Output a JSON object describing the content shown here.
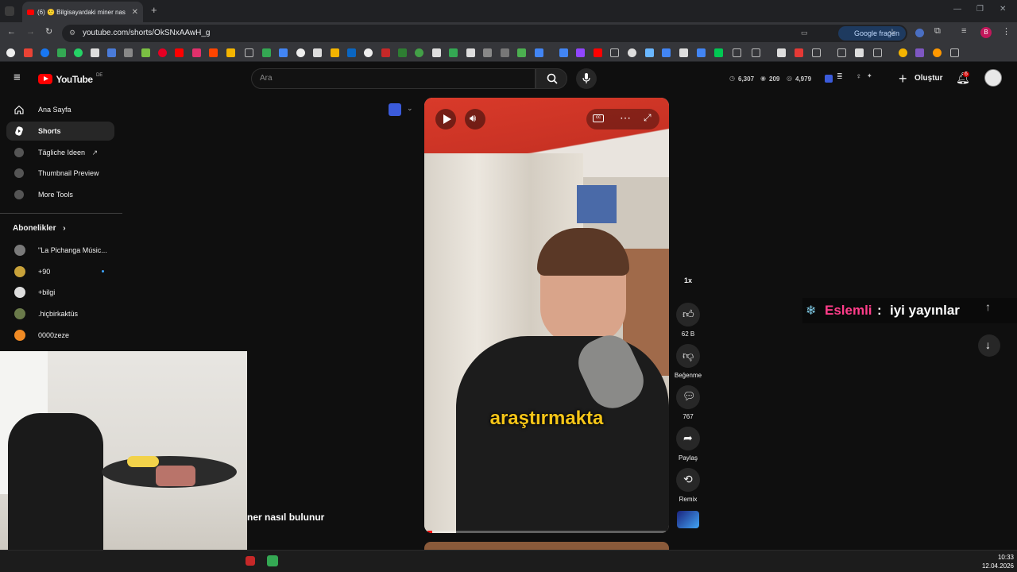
{
  "browser": {
    "tab_title": "(6) 🙂 Bilgisayardaki miner nas",
    "url": "youtube.com/shorts/OkSNxAAwH_g",
    "lens_button": "Google fragen",
    "profile_letter": "B"
  },
  "youtube": {
    "logo_text": "YouTube",
    "logo_region": "DE",
    "search_placeholder": "Ara",
    "stats": {
      "likes": "6,307",
      "views": "209",
      "subs": "4,979"
    },
    "create_label": "Oluştur",
    "notification_count": "6"
  },
  "sidebar": {
    "items": [
      {
        "label": "Ana Sayfa",
        "icon": "home-icon"
      },
      {
        "label": "Shorts",
        "icon": "shorts-icon",
        "active": true
      },
      {
        "label": "Tägliche Ideen",
        "icon": "extension-icon"
      },
      {
        "label": "Thumbnail Preview",
        "icon": "extension-icon"
      },
      {
        "label": "More Tools",
        "icon": "extension-icon"
      }
    ],
    "subscriptions_title": "Abonelikler",
    "subscriptions": [
      {
        "label": "\"La Pichanga Músic...",
        "color": "#7a7a7a"
      },
      {
        "label": "+90",
        "color": "#c8a23a"
      },
      {
        "label": "+bilgi",
        "color": "#dddddd"
      },
      {
        "label": ".hiçbirkaktüs",
        "color": "#6a7a4a"
      },
      {
        "label": "0000zeze",
        "color": "#f08a24"
      }
    ]
  },
  "video": {
    "caption": "araştırmakta",
    "partial_title": "ner nasıl bulunur"
  },
  "actions": {
    "speed": "1x",
    "likes": "62 B",
    "dislike": "Beğenme",
    "comments": "767",
    "share": "Paylaş",
    "remix": "Remix"
  },
  "chat": {
    "name": "Eslemli",
    "separator": ":",
    "message": "iyi yayınlar"
  },
  "taskbar": {
    "time": "10:33",
    "date": "12.04.2026"
  },
  "colors": {
    "yt_red": "#ff0000",
    "chat_name": "#ff3d8a",
    "caption": "#f5c518"
  }
}
